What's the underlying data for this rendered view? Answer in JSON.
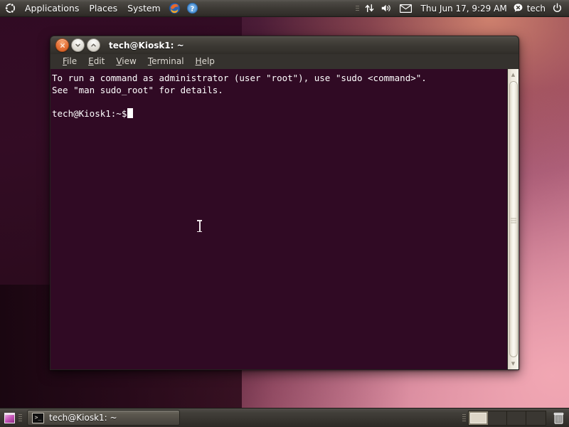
{
  "desktop": {
    "wallpaper_colors": {
      "top_left": "#300a22",
      "bottom_right": "#e8a8b4",
      "glow": "#ffa882"
    }
  },
  "top_panel": {
    "logo_icon": "ubuntu-logo-icon",
    "menus": [
      {
        "label": "Applications",
        "name": "applications-menu"
      },
      {
        "label": "Places",
        "name": "places-menu"
      },
      {
        "label": "System",
        "name": "system-menu"
      }
    ],
    "launchers": [
      {
        "name": "firefox-launcher-icon",
        "icon": "firefox-icon"
      },
      {
        "name": "help-launcher-icon",
        "icon": "help-icon"
      }
    ],
    "indicators": {
      "network_icon": "network-updown-icon",
      "volume_icon": "volume-speaker-icon",
      "mail_icon": "envelope-icon",
      "clock": "Thu Jun 17,  9:29 AM",
      "user_icon": "user-status-icon",
      "username": "tech",
      "power_icon": "power-icon"
    }
  },
  "terminal_window": {
    "title": "tech@Kiosk1: ~",
    "controls": {
      "close": "×",
      "minimize": "⌄",
      "maximize": "⌃"
    },
    "menubar": [
      {
        "name": "menu-file",
        "accel": "F",
        "rest": "ile"
      },
      {
        "name": "menu-edit",
        "accel": "E",
        "rest": "dit"
      },
      {
        "name": "menu-view",
        "accel": "V",
        "rest": "iew"
      },
      {
        "name": "menu-terminal",
        "accel": "T",
        "rest": "erminal"
      },
      {
        "name": "menu-help",
        "accel": "H",
        "rest": "elp"
      }
    ],
    "background_color": "#300a24",
    "foreground_color": "#ffffff",
    "content": {
      "line1": "To run a command as administrator (user \"root\"), use \"sudo <command>\".",
      "line2": "See \"man sudo_root\" for details.",
      "line3": "",
      "prompt": "tech@Kiosk1:~$"
    },
    "scrollbar": {
      "up_arrow": "▲",
      "down_arrow": "▼"
    }
  },
  "bottom_panel": {
    "show_desktop_icon": "show-desktop-icon",
    "task_button": {
      "icon": "terminal-icon",
      "label": "tech@Kiosk1: ~"
    },
    "workspaces": [
      {
        "name": "workspace-1",
        "active": true
      },
      {
        "name": "workspace-2",
        "active": false
      },
      {
        "name": "workspace-3",
        "active": false
      },
      {
        "name": "workspace-4",
        "active": false
      }
    ],
    "trash_icon": "trash-icon"
  }
}
